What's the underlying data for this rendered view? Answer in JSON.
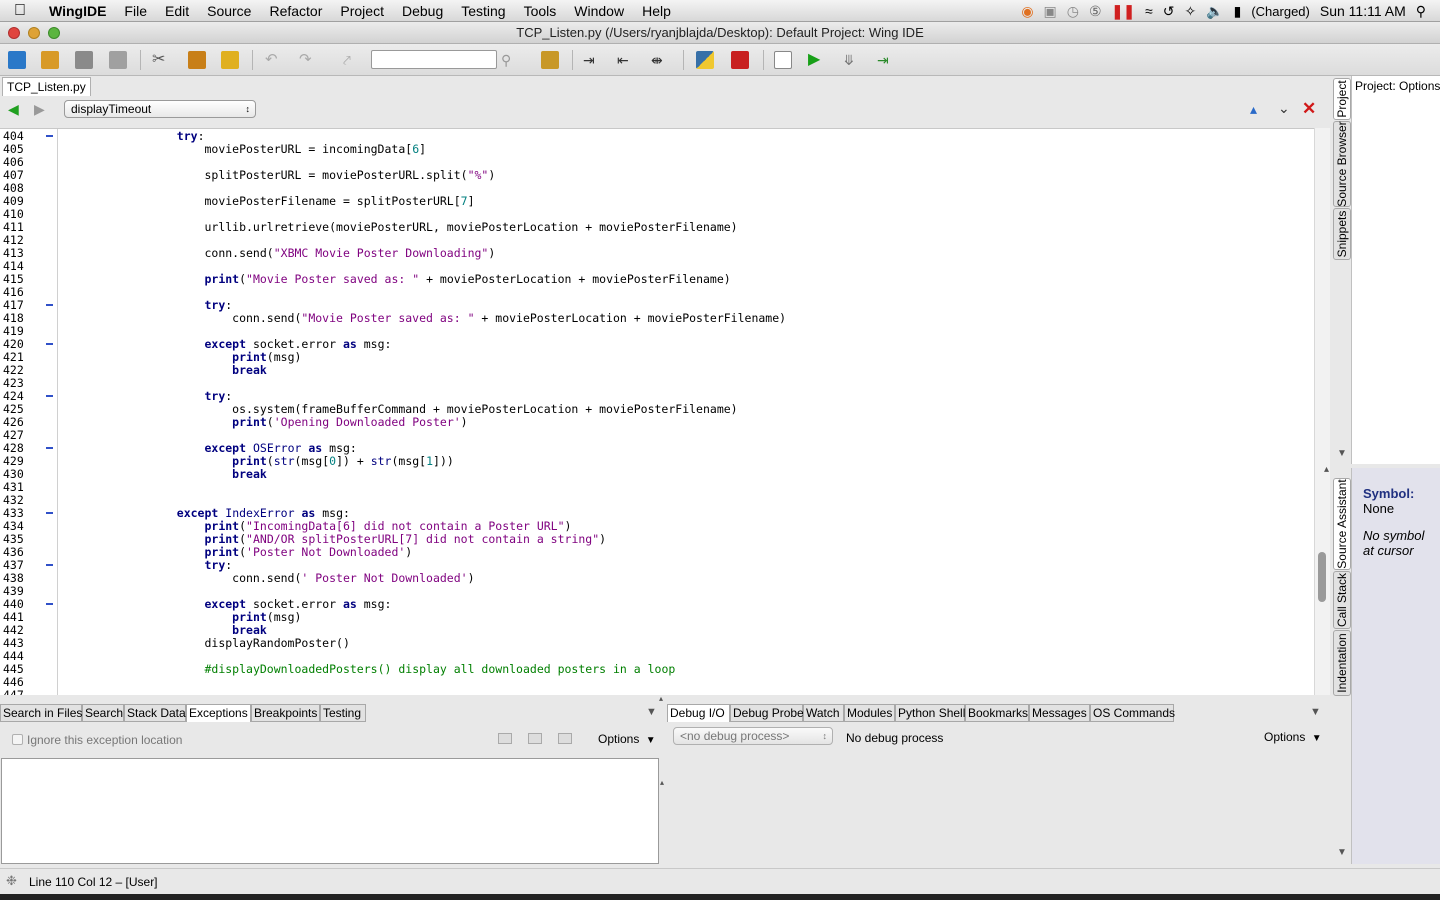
{
  "menubar": {
    "apple_icon": "apple-icon",
    "app_name": "WingIDE",
    "items": [
      "File",
      "Edit",
      "Source",
      "Refactor",
      "Project",
      "Debug",
      "Testing",
      "Tools",
      "Window",
      "Help"
    ],
    "battery_status": "(Charged)",
    "clock": "Sun 11:11 AM"
  },
  "window": {
    "title": "TCP_Listen.py (/Users/ryanjblajda/Desktop): Default Project: Wing IDE"
  },
  "toolbar": {
    "search_value": ""
  },
  "editor": {
    "file_tab": "TCP_Listen.py",
    "function_selector": "displayTimeout",
    "lines": [
      {
        "n": "404",
        "fold": true,
        "indent": "                ",
        "html": "<span class='kw'>try</span>:"
      },
      {
        "n": "405",
        "fold": false,
        "indent": "                    ",
        "html": "moviePosterURL = incomingData[<span class='num'>6</span>]"
      },
      {
        "n": "406",
        "fold": false,
        "indent": "",
        "html": ""
      },
      {
        "n": "407",
        "fold": false,
        "indent": "                    ",
        "html": "splitPosterURL = moviePosterURL.split(<span class='str'>\"%\"</span>)"
      },
      {
        "n": "408",
        "fold": false,
        "indent": "",
        "html": ""
      },
      {
        "n": "409",
        "fold": false,
        "indent": "                    ",
        "html": "moviePosterFilename = splitPosterURL[<span class='num'>7</span>]"
      },
      {
        "n": "410",
        "fold": false,
        "indent": "",
        "html": ""
      },
      {
        "n": "411",
        "fold": false,
        "indent": "                    ",
        "html": "urllib.urlretrieve(moviePosterURL, moviePosterLocation + moviePosterFilename)"
      },
      {
        "n": "412",
        "fold": false,
        "indent": "",
        "html": ""
      },
      {
        "n": "413",
        "fold": false,
        "indent": "                    ",
        "html": "conn.send(<span class='str'>\"XBMC Movie Poster Downloading\"</span>)"
      },
      {
        "n": "414",
        "fold": false,
        "indent": "",
        "html": ""
      },
      {
        "n": "415",
        "fold": false,
        "indent": "                    ",
        "html": "<span class='kw'>print</span>(<span class='str'>\"Movie Poster saved as: \"</span> + moviePosterLocation + moviePosterFilename)"
      },
      {
        "n": "416",
        "fold": false,
        "indent": "",
        "html": ""
      },
      {
        "n": "417",
        "fold": true,
        "indent": "                    ",
        "html": "<span class='kw'>try</span>:"
      },
      {
        "n": "418",
        "fold": false,
        "indent": "                        ",
        "html": "conn.send(<span class='str'>\"Movie Poster saved as: \"</span> + moviePosterLocation + moviePosterFilename)"
      },
      {
        "n": "419",
        "fold": false,
        "indent": "",
        "html": ""
      },
      {
        "n": "420",
        "fold": true,
        "indent": "                    ",
        "html": "<span class='kw'>except</span> socket.error <span class='kw'>as</span> msg:"
      },
      {
        "n": "421",
        "fold": false,
        "indent": "                        ",
        "html": "<span class='kw'>print</span>(msg)"
      },
      {
        "n": "422",
        "fold": false,
        "indent": "                        ",
        "html": "<span class='kw'>break</span>"
      },
      {
        "n": "423",
        "fold": false,
        "indent": "",
        "html": ""
      },
      {
        "n": "424",
        "fold": true,
        "indent": "                    ",
        "html": "<span class='kw'>try</span>:"
      },
      {
        "n": "425",
        "fold": false,
        "indent": "                        ",
        "html": "os.system(frameBufferCommand + moviePosterLocation + moviePosterFilename)"
      },
      {
        "n": "426",
        "fold": false,
        "indent": "                        ",
        "html": "<span class='kw'>print</span>(<span class='str'>'Opening Downloaded Poster'</span>)"
      },
      {
        "n": "427",
        "fold": false,
        "indent": "",
        "html": ""
      },
      {
        "n": "428",
        "fold": true,
        "indent": "                    ",
        "html": "<span class='kw'>except</span> <span class='exc'>OSError</span> <span class='kw'>as</span> msg:"
      },
      {
        "n": "429",
        "fold": false,
        "indent": "                        ",
        "html": "<span class='kw'>print</span>(<span class='bi'>str</span>(msg[<span class='num'>0</span>]) + <span class='bi'>str</span>(msg[<span class='num'>1</span>]))"
      },
      {
        "n": "430",
        "fold": false,
        "indent": "                        ",
        "html": "<span class='kw'>break</span>"
      },
      {
        "n": "431",
        "fold": false,
        "indent": "",
        "html": ""
      },
      {
        "n": "432",
        "fold": false,
        "indent": "",
        "html": ""
      },
      {
        "n": "433",
        "fold": true,
        "indent": "                ",
        "html": "<span class='kw'>except</span> <span class='exc'>IndexError</span> <span class='kw'>as</span> msg:"
      },
      {
        "n": "434",
        "fold": false,
        "indent": "                    ",
        "html": "<span class='kw'>print</span>(<span class='str'>\"IncomingData[6] did not contain a Poster URL\"</span>)"
      },
      {
        "n": "435",
        "fold": false,
        "indent": "                    ",
        "html": "<span class='kw'>print</span>(<span class='str'>\"AND/OR splitPosterURL[7] did not contain a string\"</span>)"
      },
      {
        "n": "436",
        "fold": false,
        "indent": "                    ",
        "html": "<span class='kw'>print</span>(<span class='str'>'Poster Not Downloaded'</span>)"
      },
      {
        "n": "437",
        "fold": true,
        "indent": "                    ",
        "html": "<span class='kw'>try</span>:"
      },
      {
        "n": "438",
        "fold": false,
        "indent": "                        ",
        "html": "conn.send(<span class='str'>' Poster Not Downloaded'</span>)"
      },
      {
        "n": "439",
        "fold": false,
        "indent": "",
        "html": ""
      },
      {
        "n": "440",
        "fold": true,
        "indent": "                    ",
        "html": "<span class='kw'>except</span> socket.error <span class='kw'>as</span> msg:"
      },
      {
        "n": "441",
        "fold": false,
        "indent": "                        ",
        "html": "<span class='kw'>print</span>(msg)"
      },
      {
        "n": "442",
        "fold": false,
        "indent": "                        ",
        "html": "<span class='kw'>break</span>"
      },
      {
        "n": "443",
        "fold": false,
        "indent": "                    ",
        "html": "displayRandomPoster()"
      },
      {
        "n": "444",
        "fold": false,
        "indent": "",
        "html": ""
      },
      {
        "n": "445",
        "fold": false,
        "indent": "                    ",
        "html": "<span class='cmt'>#displayDownloadedPosters() display all downloaded posters in a loop</span>"
      },
      {
        "n": "446",
        "fold": false,
        "indent": "",
        "html": ""
      },
      {
        "n": "447",
        "fold": false,
        "indent": "",
        "html": ""
      }
    ]
  },
  "side_tabs": {
    "top": [
      "Project",
      "Source Browser",
      "Snippets"
    ],
    "bottom": [
      "Source Assistant",
      "Call Stack",
      "Indentation"
    ]
  },
  "project_panel": {
    "title": "Project: Options"
  },
  "source_assistant": {
    "symbol_label": "Symbol:",
    "symbol_value": "None",
    "note": "No symbol at cursor"
  },
  "bottom_left": {
    "tabs": [
      "Search in Files",
      "Search",
      "Stack Data",
      "Exceptions",
      "Breakpoints",
      "Testing"
    ],
    "active_tab": "Exceptions",
    "ignore_label": "Ignore this exception location",
    "options_label": "Options"
  },
  "bottom_right": {
    "tabs": [
      "Debug I/O",
      "Debug Probe",
      "Watch",
      "Modules",
      "Python Shell",
      "Bookmarks",
      "Messages",
      "OS Commands"
    ],
    "active_tab": "Debug I/O",
    "process_select": "<no debug process>",
    "process_status": "No debug process",
    "options_label": "Options"
  },
  "statusbar": {
    "text": "Line 110 Col 12 – [User]"
  },
  "colors": {
    "keyword": "#00007f",
    "string": "#7f007f",
    "number": "#007f7f",
    "comment": "#007f00",
    "fold_marker": "#3050c8"
  }
}
